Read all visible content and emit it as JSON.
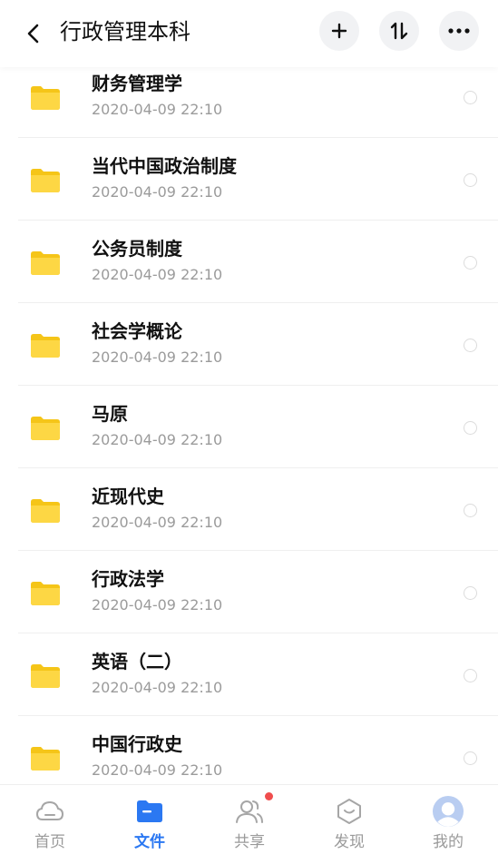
{
  "header": {
    "title": "行政管理本科"
  },
  "icons": {
    "back": "chevron-left-icon",
    "add": "plus-icon",
    "sort": "sort-icon",
    "more": "more-horizontal-icon",
    "folder": "folder-icon"
  },
  "colors": {
    "folder": "#fdd744",
    "folder_tab": "#f5c518",
    "accent": "#2b78f2",
    "badge": "#f04d4d"
  },
  "files": [
    {
      "name": "财务管理学",
      "time": "2020-04-09  22:10"
    },
    {
      "name": "当代中国政治制度",
      "time": "2020-04-09  22:10"
    },
    {
      "name": "公务员制度",
      "time": "2020-04-09  22:10"
    },
    {
      "name": "社会学概论",
      "time": "2020-04-09  22:10"
    },
    {
      "name": "马原",
      "time": "2020-04-09  22:10"
    },
    {
      "name": "近现代史",
      "time": "2020-04-09  22:10"
    },
    {
      "name": "行政法学",
      "time": "2020-04-09  22:10"
    },
    {
      "name": "英语（二）",
      "time": "2020-04-09  22:10"
    },
    {
      "name": "中国行政史",
      "time": "2020-04-09  22:10"
    }
  ],
  "tabs": [
    {
      "label": "首页",
      "icon": "cloud-icon",
      "active": false
    },
    {
      "label": "文件",
      "icon": "folder-icon",
      "active": true
    },
    {
      "label": "共享",
      "icon": "people-icon",
      "active": false,
      "badge": true
    },
    {
      "label": "发现",
      "icon": "discover-icon",
      "active": false
    },
    {
      "label": "我的",
      "icon": "avatar-icon",
      "active": false
    }
  ]
}
